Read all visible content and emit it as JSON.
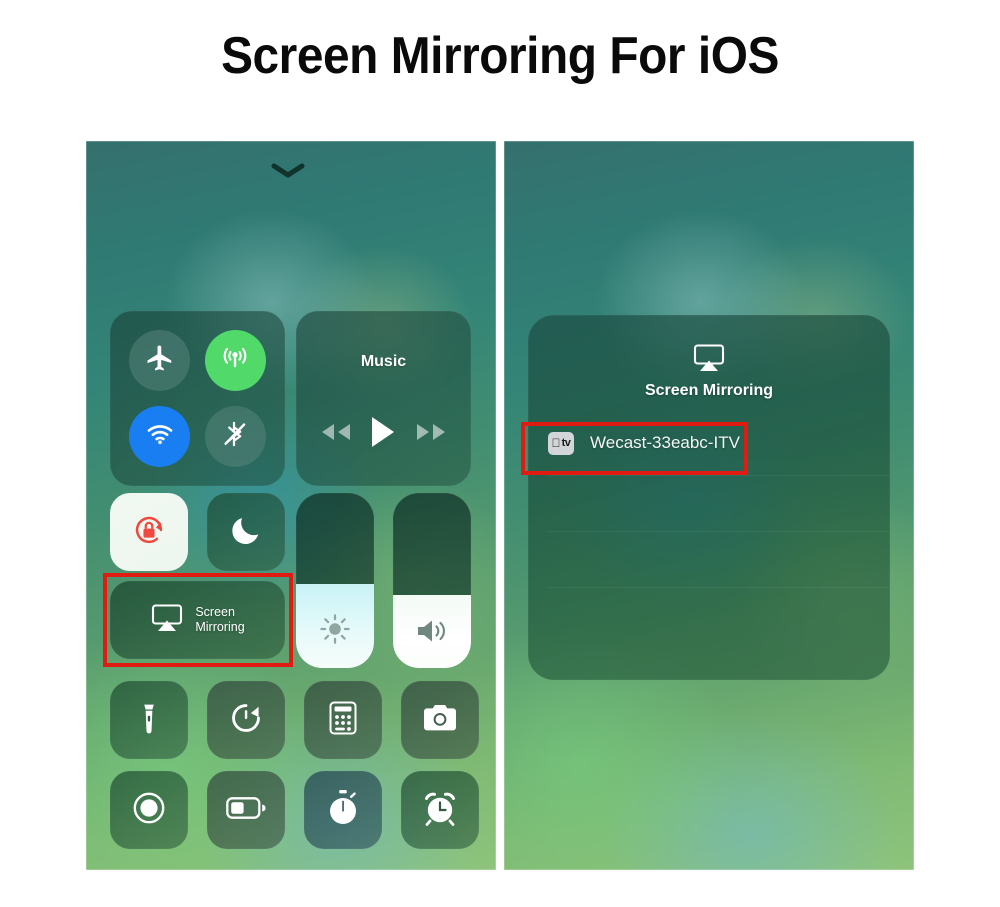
{
  "page": {
    "title": "Screen Mirroring For iOS",
    "accent_red": "#e01b12",
    "background": "#ffffff"
  },
  "left_panel": {
    "name": "ios-control-center",
    "grabber_icon": "chevron-down-icon",
    "connectivity": {
      "airplane": {
        "icon": "airplane-icon",
        "state": "off"
      },
      "cellular": {
        "icon": "cellular-data-icon",
        "state": "on",
        "color": "#51d96a"
      },
      "wifi": {
        "icon": "wifi-icon",
        "state": "on",
        "color": "#1a7ef3"
      },
      "bluetooth": {
        "icon": "bluetooth-off-icon",
        "state": "off"
      }
    },
    "music": {
      "title": "Music",
      "prev_icon": "rewind-icon",
      "play_icon": "play-icon",
      "next_icon": "fast-forward-icon"
    },
    "toggles": {
      "rotation_lock": {
        "icon": "rotation-lock-icon",
        "state": "on",
        "color": "#f0473e"
      },
      "do_not_disturb": {
        "icon": "moon-icon",
        "state": "off"
      }
    },
    "screen_mirroring_tile": {
      "icon": "airplay-icon",
      "label_line1": "Screen",
      "label_line2": "Mirroring",
      "highlighted": true
    },
    "brightness": {
      "icon": "brightness-icon",
      "level": 48
    },
    "volume": {
      "icon": "volume-icon",
      "level": 42
    },
    "utilities_row1": [
      {
        "icon": "flashlight-icon",
        "name": "flashlight"
      },
      {
        "icon": "timer-icon",
        "name": "timer"
      },
      {
        "icon": "calculator-icon",
        "name": "calculator"
      },
      {
        "icon": "camera-icon",
        "name": "camera"
      }
    ],
    "utilities_row2": [
      {
        "icon": "screen-record-icon",
        "name": "screen-recording"
      },
      {
        "icon": "low-power-battery-icon",
        "name": "low-power-mode"
      },
      {
        "icon": "stopwatch-icon",
        "name": "stopwatch"
      },
      {
        "icon": "alarm-clock-icon",
        "name": "alarm"
      }
    ]
  },
  "right_panel": {
    "name": "screen-mirroring-sheet",
    "header_icon": "airplay-icon",
    "header_title": "Screen Mirroring",
    "devices": [
      {
        "badge_icon": "apple-tv-icon",
        "badge_apple": "",
        "badge_tv": "tv",
        "name": "Wecast-33eabc-ITV",
        "highlighted": true
      }
    ]
  }
}
